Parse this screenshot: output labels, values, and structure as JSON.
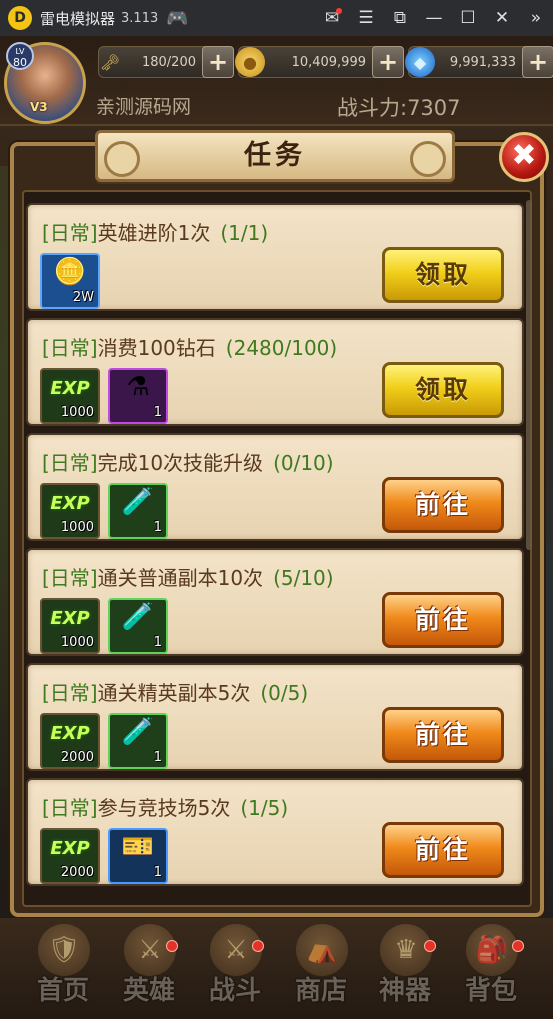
{
  "titlebar": {
    "logo": "D",
    "title": "雷电模拟器",
    "version": "3.113",
    "icons": [
      "gamepad-icon",
      "mail-icon",
      "menu-icon",
      "screenshot-icon",
      "minimize-icon",
      "maximize-icon",
      "close-icon",
      "collapse-icon"
    ]
  },
  "hud": {
    "level_label": "LV",
    "level": "80",
    "vip": "V3",
    "player_name": "亲测源码网",
    "power": "战斗力:7307",
    "stamina": "180/200",
    "gold": "10,409,999",
    "gems": "9,991,333",
    "plus": "+"
  },
  "dialog": {
    "title": "任务",
    "close": "✖"
  },
  "tasks": [
    {
      "cat": "[日常]",
      "name": "英雄进阶1次",
      "progress": "(1/1)",
      "reward1": "2W",
      "reward2": "",
      "action": "领取"
    },
    {
      "cat": "[日常]",
      "name": "消费100钻石",
      "progress": "(2480/100)",
      "reward1": "1000",
      "reward2": "1",
      "action": "领取"
    },
    {
      "cat": "[日常]",
      "name": "完成10次技能升级",
      "progress": "(0/10)",
      "reward1": "1000",
      "reward2": "1",
      "action": "前往"
    },
    {
      "cat": "[日常]",
      "name": "通关普通副本10次",
      "progress": "(5/10)",
      "reward1": "1000",
      "reward2": "1",
      "action": "前往"
    },
    {
      "cat": "[日常]",
      "name": "通关精英副本5次",
      "progress": "(0/5)",
      "reward1": "2000",
      "reward2": "1",
      "action": "前往"
    },
    {
      "cat": "[日常]",
      "name": "参与竞技场5次",
      "progress": "(1/5)",
      "reward1": "2000",
      "reward2": "1",
      "action": "前往"
    }
  ],
  "exp_text": "EXP",
  "nav": {
    "home": "首页",
    "hero": "英雄",
    "battle": "战斗",
    "shop": "商店",
    "artifact": "神器",
    "bag": "背包"
  },
  "colors": {
    "task_category": "#3f7a1e",
    "claim_button": "#f1cf1a",
    "go_button": "#f08a1a",
    "frame_gold": "#a8844a"
  }
}
